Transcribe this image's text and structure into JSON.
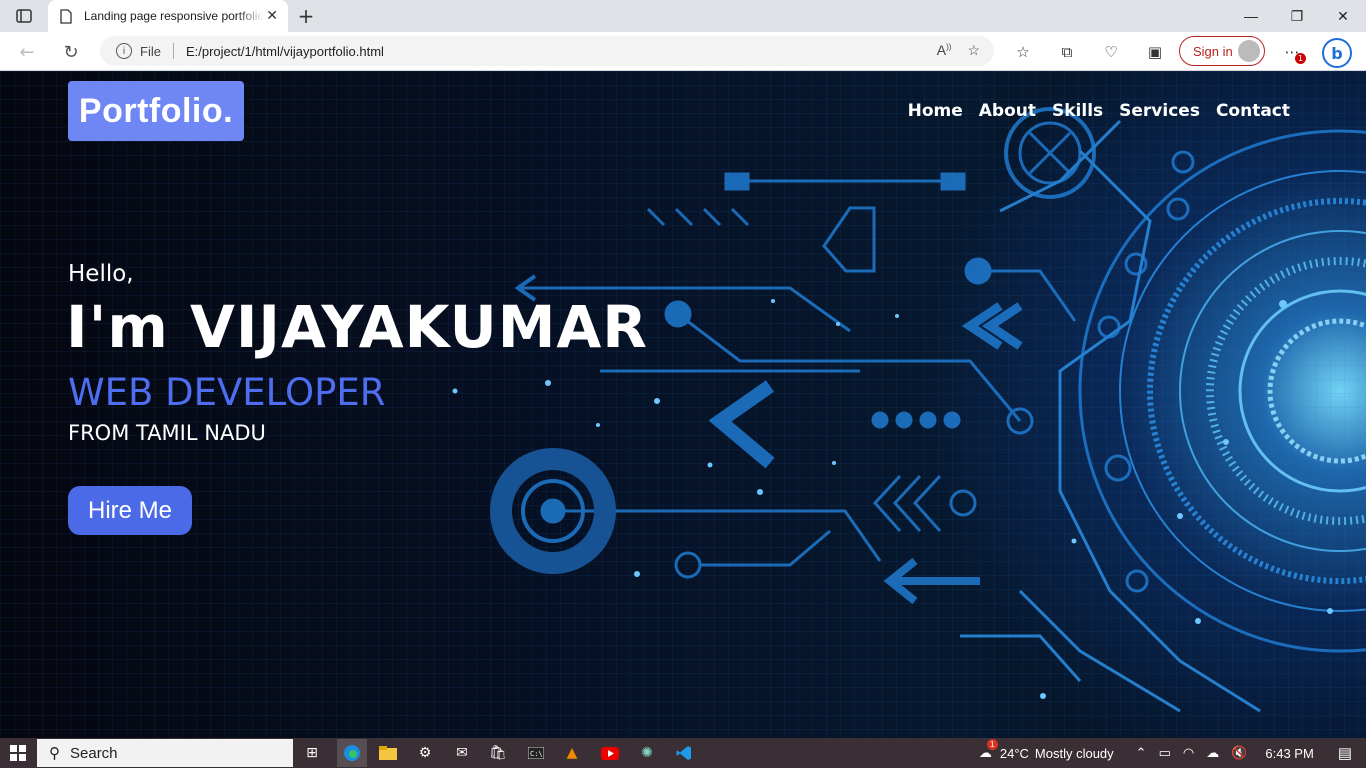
{
  "browser": {
    "tab_title": "Landing page responsive portfolio",
    "url_prefix": "File",
    "url": "E:/project/1/html/vijayportfolio.html",
    "signin_label": "Sign in",
    "notification_count": "1"
  },
  "site": {
    "logo": "Portfolio.",
    "nav": [
      "Home",
      "About",
      "Skills",
      "Services",
      "Contact"
    ],
    "greeting": "Hello,",
    "name": "I'm VIJAYAKUMAR",
    "role": "WEB DEVELOPER",
    "location": "FROM TAMIL NADU",
    "cta": "Hire Me"
  },
  "taskbar": {
    "search_label": "Search",
    "weather_temp": "24°C",
    "weather_text": "Mostly cloudy",
    "time": "6:43 PM",
    "weather_badge": "1"
  },
  "colors": {
    "accent": "#4b6ae8",
    "logo_bg": "#6f86f5",
    "role_text": "#4e6df0"
  }
}
